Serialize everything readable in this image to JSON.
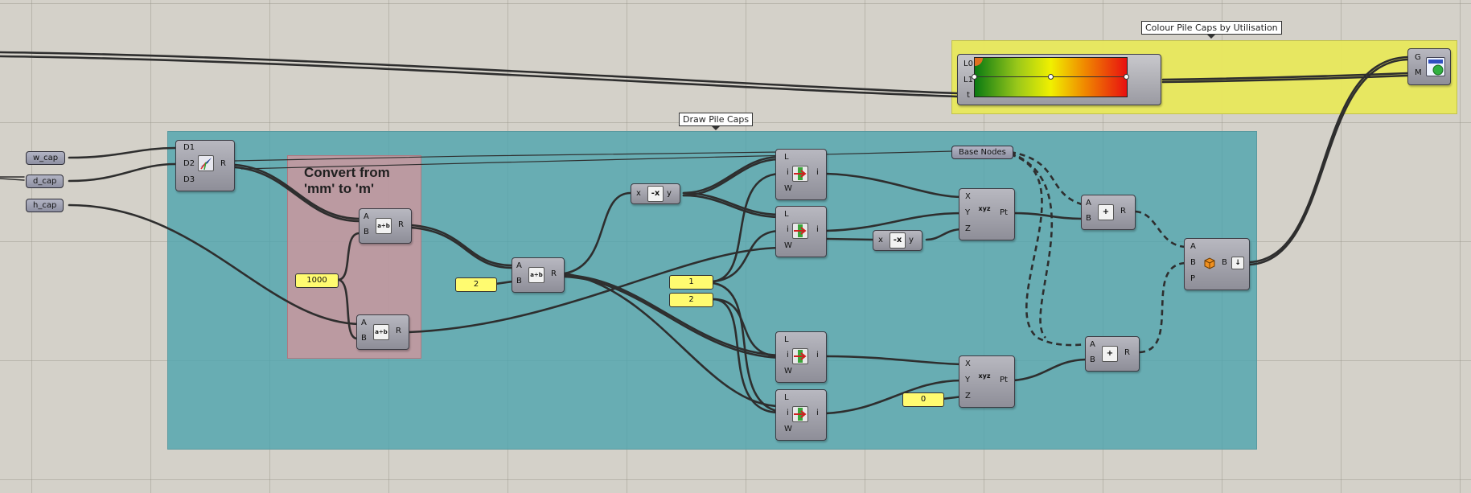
{
  "groups": {
    "colour": "Colour Pile Caps by Utilisation",
    "draw": "Draw Pile Caps",
    "convert": "Convert from 'mm' to 'm'"
  },
  "params": {
    "w_cap": "w_cap",
    "d_cap": "d_cap",
    "h_cap": "h_cap",
    "base_nodes": "Base Nodes"
  },
  "panels": {
    "p1000": "1000",
    "p2a": "2",
    "p1": "1",
    "p2b": "2",
    "p0": "0"
  },
  "ports": {
    "d1": "D1",
    "d2": "D2",
    "d3": "D3",
    "r": "R",
    "a": "A",
    "b": "B",
    "x": "x",
    "y": "y",
    "l": "L",
    "i": "i",
    "w": "W",
    "xu": "X",
    "yu": "Y",
    "zu": "Z",
    "pt": "Pt",
    "p": "P",
    "g": "G",
    "m": "M",
    "l0": "L0",
    "l1": "L1",
    "t": "t"
  },
  "icons": {
    "divide": "a÷b",
    "negate": "-x",
    "add": "+",
    "xyz": "xyz",
    "arrow": "↓"
  },
  "colors": {
    "wire": "#2e2e2e",
    "teal_group": "#4ca4ae",
    "pink_group": "#cd969e",
    "yellow_group": "#e8e85c",
    "panel": "#fffb70"
  }
}
